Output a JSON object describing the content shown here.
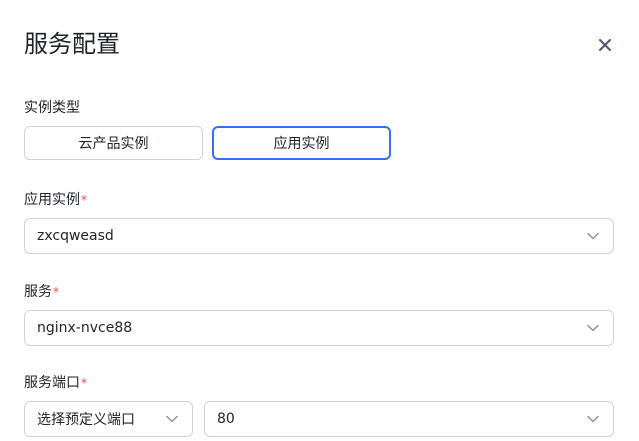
{
  "dialog": {
    "title": "服务配置",
    "close_icon": "close-icon"
  },
  "instance_type": {
    "label": "实例类型",
    "options": [
      "云产品实例",
      "应用实例"
    ],
    "selected": "应用实例"
  },
  "app_instance": {
    "label": "应用实例",
    "required_mark": "*",
    "value": "zxcqweasd"
  },
  "service": {
    "label": "服务",
    "required_mark": "*",
    "value": "nginx-nvce88"
  },
  "service_port": {
    "label": "服务端口",
    "required_mark": "*",
    "mode_value": "选择预定义端口",
    "port_value": "80"
  },
  "colors": {
    "accent": "#3370ff",
    "border": "#d0d3d6",
    "required": "#f54a45",
    "text": "#1f2329"
  }
}
